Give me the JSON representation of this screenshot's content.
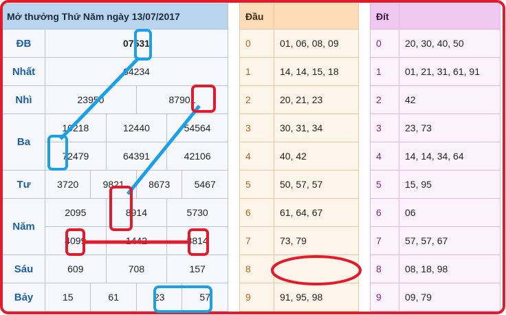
{
  "results": {
    "title": "Mở thưởng Thứ Năm ngày 13/07/2017",
    "rows": [
      {
        "label": "ĐB",
        "cells": [
          "07531"
        ]
      },
      {
        "label": "Nhất",
        "cells": [
          "64234"
        ]
      },
      {
        "label": "Nhì",
        "cells": [
          "23950",
          "87901"
        ]
      },
      {
        "label": "Ba",
        "cells": [
          "10218",
          "12440",
          "54564",
          "72479",
          "64391",
          "42106"
        ]
      },
      {
        "label": "Tư",
        "cells": [
          "3720",
          "9821",
          "8673",
          "5467"
        ]
      },
      {
        "label": "Năm",
        "cells": [
          "2095",
          "8914",
          "5730",
          "4099",
          "1442",
          "8814"
        ]
      },
      {
        "label": "Sáu",
        "cells": [
          "609",
          "708",
          "157"
        ]
      },
      {
        "label": "Bảy",
        "cells": [
          "15",
          "61",
          "23",
          "57"
        ]
      }
    ]
  },
  "dau": {
    "header": "Đầu",
    "rows": [
      {
        "digit": "0",
        "values": "01, 06, 08, 09"
      },
      {
        "digit": "1",
        "values": "14, 14, 15, 18"
      },
      {
        "digit": "2",
        "values": "20, 21, 23"
      },
      {
        "digit": "3",
        "values": "30, 31, 34"
      },
      {
        "digit": "4",
        "values": "40, 42"
      },
      {
        "digit": "5",
        "values": "50, 57, 57"
      },
      {
        "digit": "6",
        "values": "61, 64, 67"
      },
      {
        "digit": "7",
        "values": "73, 79"
      },
      {
        "digit": "8",
        "values": ""
      },
      {
        "digit": "9",
        "values": "91, 95, 98"
      }
    ]
  },
  "dit": {
    "header": "Đít",
    "rows": [
      {
        "digit": "0",
        "values": "20, 30, 40, 50"
      },
      {
        "digit": "1",
        "values": "01, 21, 31, 61, 91"
      },
      {
        "digit": "2",
        "values": "42"
      },
      {
        "digit": "3",
        "values": "23, 73"
      },
      {
        "digit": "4",
        "values": "14, 14, 34, 64"
      },
      {
        "digit": "5",
        "values": "15, 95"
      },
      {
        "digit": "6",
        "values": "06"
      },
      {
        "digit": "7",
        "values": "57, 57, 67"
      },
      {
        "digit": "8",
        "values": "08, 18, 98"
      },
      {
        "digit": "9",
        "values": "09, 79"
      }
    ]
  },
  "colors": {
    "annotation_red": "#e01b2b",
    "annotation_blue": "#1aa0e6",
    "special_prize": "#e0141b"
  }
}
